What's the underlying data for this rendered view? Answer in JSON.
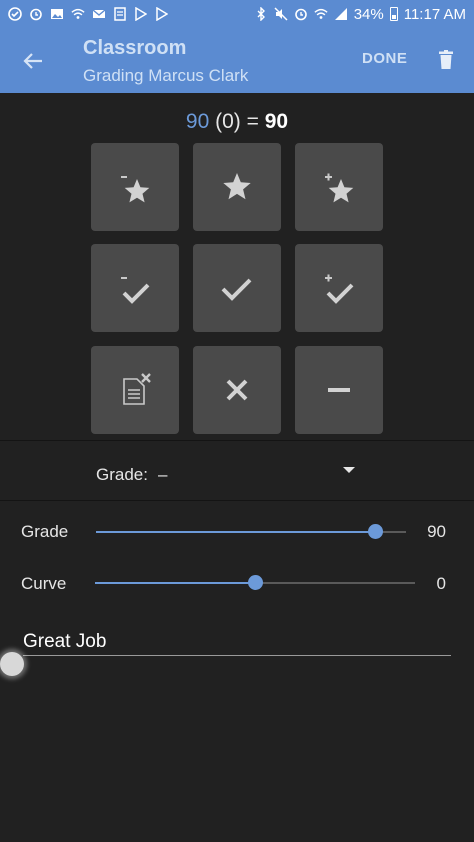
{
  "status_bar": {
    "left_icons": [
      "wifi-calling-icon",
      "alarm-icon",
      "image-icon",
      "wifi-icon",
      "mail-icon",
      "document-icon",
      "play-store-icon",
      "play-store-icon"
    ],
    "battery": "34%",
    "time": "11:17 AM"
  },
  "app_bar": {
    "title": "Classroom",
    "subtitle": "Grading Marcus Clark",
    "done_label": "DONE",
    "back_icon": "arrow-back-icon",
    "delete_icon": "trash-icon"
  },
  "score": {
    "raw": "90",
    "curve": "(0)",
    "equals": "=",
    "final": "90"
  },
  "grade_buttons": [
    {
      "icon": "star-minus-icon"
    },
    {
      "icon": "star-icon"
    },
    {
      "icon": "star-plus-icon"
    },
    {
      "icon": "check-minus-icon"
    },
    {
      "icon": "check-icon"
    },
    {
      "icon": "check-plus-icon"
    },
    {
      "icon": "missing-document-icon"
    },
    {
      "icon": "x-icon"
    },
    {
      "icon": "dash-icon"
    }
  ],
  "grade_select": {
    "label": "Grade:",
    "value": "–"
  },
  "sliders": {
    "grade": {
      "label": "Grade",
      "value": "90",
      "fraction": 0.9
    },
    "curve": {
      "label": "Curve",
      "value": "0",
      "fraction": 0.5
    }
  },
  "comment": {
    "value": "Great Job"
  },
  "colors": {
    "primary": "#5b8bd1",
    "accent": "#6c9ad9",
    "background": "#212121",
    "button": "#4a4a4a"
  }
}
